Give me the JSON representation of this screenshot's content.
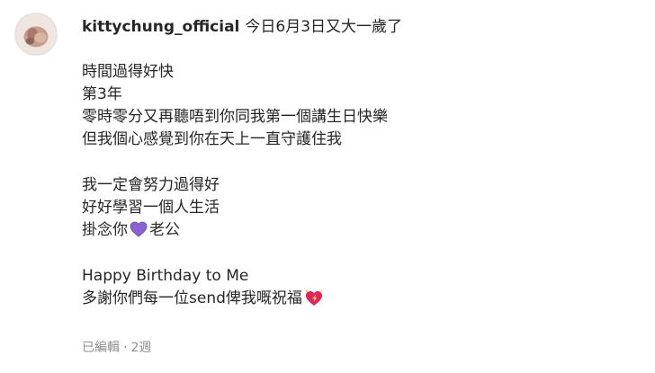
{
  "post": {
    "username": "kittychung_official",
    "first_line": "今日6月3日又大一歲了",
    "paragraphs": [
      {
        "lines": [
          "時間過得好快",
          "第3年",
          "零時零分又再聽唔到你同我第一個講生日快樂",
          "但我個心感覺到你在天上一直守護住我"
        ]
      },
      {
        "lines": [
          "我一定會努力過得好",
          "好好學習一個人生活"
        ],
        "last_line_before_emoji": "掛念你",
        "last_line_emoji": "purple-heart",
        "last_line_after_emoji": "老公"
      },
      {
        "lines": [
          "Happy Birthday to Me"
        ],
        "last_line_before_emoji": "多謝你們每一位send俾我嘅祝福",
        "last_line_emoji": "sparkling-heart"
      }
    ],
    "meta": {
      "edited": "已編輯",
      "separator": "·",
      "time": "2週"
    }
  },
  "colors": {
    "text": "#262626",
    "meta": "#8e8e8e",
    "purple_heart": "#8a63d2",
    "spark_heart": "#e0245e"
  }
}
